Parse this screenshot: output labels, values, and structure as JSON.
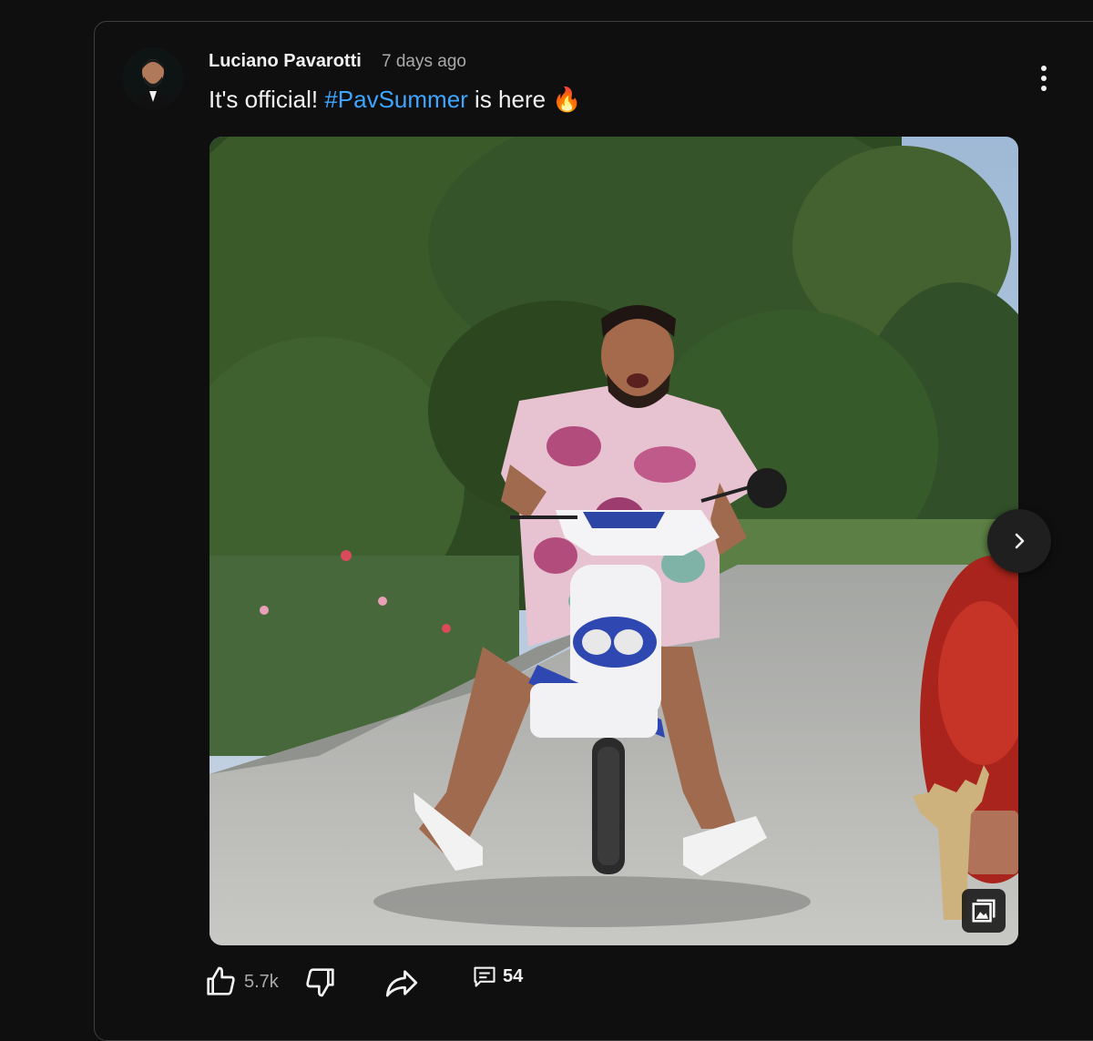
{
  "post": {
    "author": "Luciano Pavarotti",
    "time": "7 days ago",
    "text_before": "It's official! ",
    "hashtag": "#PavSummer",
    "text_after": " is here 🔥"
  },
  "actions": {
    "likes": "5.7k",
    "comments": "54"
  },
  "icons": {
    "menu": "more-vertical-icon",
    "next": "chevron-right-icon",
    "gallery": "image-gallery-icon",
    "like": "thumbs-up-icon",
    "dislike": "thumbs-down-icon",
    "share": "share-icon",
    "comment": "comment-icon"
  },
  "colors": {
    "background": "#0f0f0f",
    "hashtag": "#3ea6ff",
    "secondary_text": "#aaaaaa"
  }
}
